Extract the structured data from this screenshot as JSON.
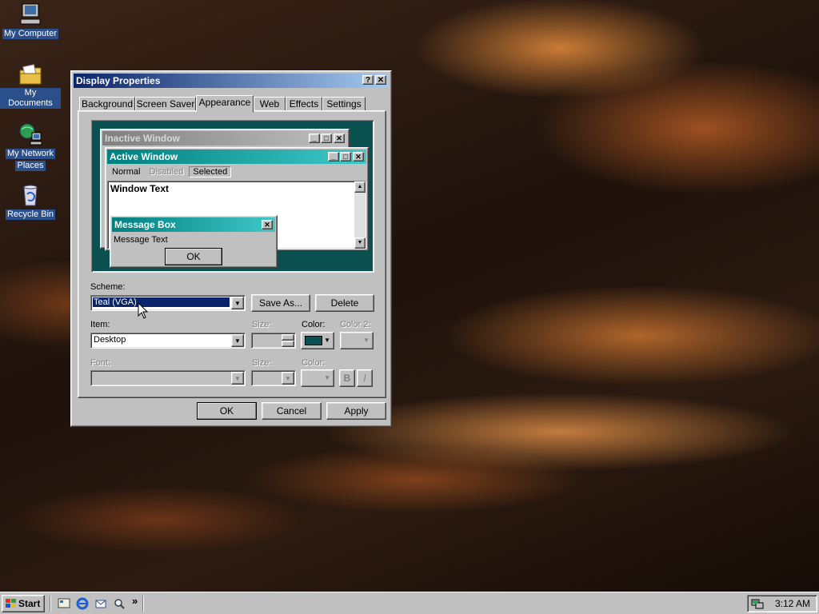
{
  "desktop": {
    "icons": [
      {
        "label": "My Computer",
        "icon": "my-computer-icon"
      },
      {
        "label": "My Documents",
        "icon": "my-documents-icon"
      },
      {
        "label_line1": "My Network",
        "label_line2": "Places",
        "icon": "network-places-icon"
      },
      {
        "label": "Recycle Bin",
        "icon": "recycle-bin-icon"
      }
    ]
  },
  "window": {
    "title": "Display Properties",
    "help_button": "?",
    "close_button": "✕",
    "tabs": [
      "Background",
      "Screen Saver",
      "Appearance",
      "Web",
      "Effects",
      "Settings"
    ],
    "active_tab": "Appearance"
  },
  "preview": {
    "inactive_title": "Inactive Window",
    "active_title": "Active Window",
    "menu": {
      "normal": "Normal",
      "disabled": "Disabled",
      "selected": "Selected"
    },
    "window_text": "Window Text",
    "message_title": "Message Box",
    "message_text": "Message Text",
    "ok": "OK",
    "desktop_color": "#0b5050",
    "active_color": "#008080",
    "inactive_color": "#808080"
  },
  "scheme": {
    "label": "Scheme:",
    "value": "Teal (VGA)",
    "save_as": "Save As...",
    "delete": "Delete"
  },
  "item": {
    "label": "Item:",
    "value": "Desktop",
    "size_label": "Size:",
    "color_label": "Color:",
    "color2_label": "Color 2:",
    "color_value": "#0b5050"
  },
  "font": {
    "label": "Font:",
    "size_label": "Size:",
    "color_label": "Color:",
    "bold": "B",
    "italic": "I"
  },
  "footer": {
    "ok": "OK",
    "cancel": "Cancel",
    "apply": "Apply"
  },
  "taskbar": {
    "start": "Start",
    "chevron": "»",
    "clock": "3:12 AM"
  }
}
